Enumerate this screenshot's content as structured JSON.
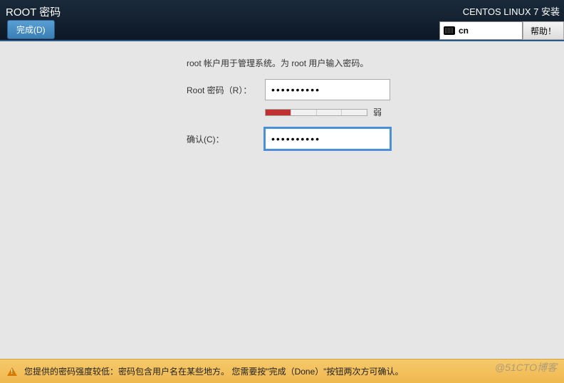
{
  "header": {
    "title": "ROOT 密码",
    "done_label": "完成(D)",
    "installer_title": "CENTOS LINUX 7 安装"
  },
  "lang": {
    "code": "cn",
    "help_label": "帮助！"
  },
  "form": {
    "description": "root 帐户用于管理系统。为 root 用户输入密码。",
    "password_label": "Root 密码（R）：",
    "password_value": "••••••••••",
    "confirm_label": "确认(C)：",
    "confirm_value": "••••••••••",
    "strength_label": "弱"
  },
  "footer": {
    "message": "您提供的密码强度较低：密码包含用户名在某些地方。 您需要按\"完成（Done）\"按钮两次方可确认。"
  },
  "watermark": "@51CTO博客"
}
